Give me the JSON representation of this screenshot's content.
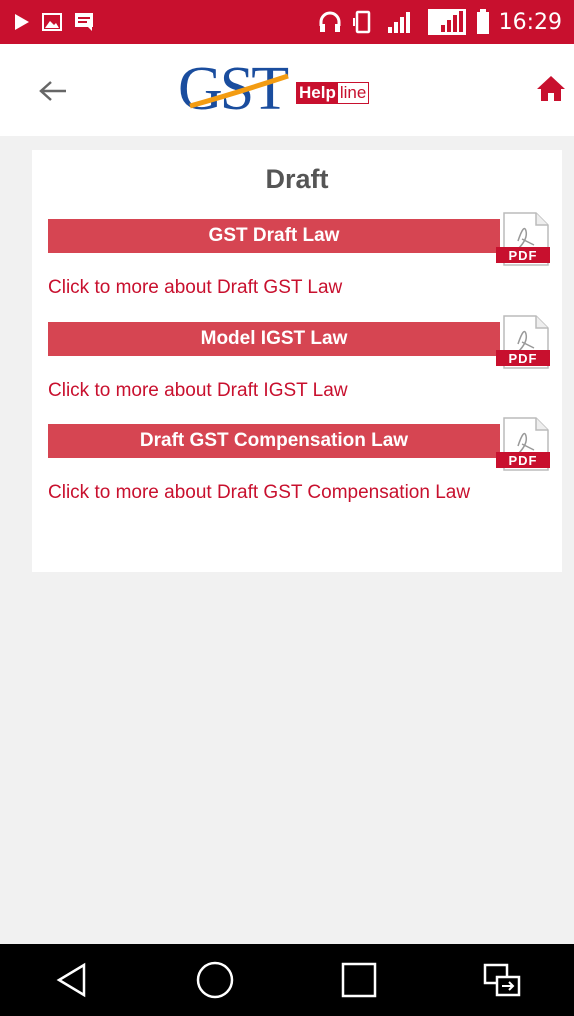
{
  "status_bar": {
    "time": "16:29",
    "icons": [
      "play-icon",
      "image-icon",
      "message-icon",
      "headset-icon",
      "vibrate-icon",
      "signal-icon",
      "signal-icon",
      "battery-icon"
    ]
  },
  "app_bar": {
    "logo_gst": "GST",
    "logo_help": "Help",
    "logo_line": "line",
    "back_icon": "arrow-left-icon",
    "home_icon": "home-icon"
  },
  "card": {
    "title": "Draft",
    "items": [
      {
        "heading": "GST Draft Law",
        "link": "Click to more about Draft GST Law",
        "icon_label": "PDF"
      },
      {
        "heading": "Model IGST Law",
        "link": "Click to more about Draft IGST Law",
        "icon_label": "PDF"
      },
      {
        "heading": "Draft GST Compensation Law",
        "link": "Click to more about Draft GST Compensation Law",
        "icon_label": "PDF"
      }
    ]
  },
  "nav_bar": {
    "buttons": [
      "back-triangle-icon",
      "home-circle-icon",
      "recents-square-icon",
      "switch-app-icon"
    ]
  },
  "colors": {
    "status_bar": "#c8102e",
    "accent": "#c8102e",
    "bar": "#d64552",
    "logo_blue": "#1a4d9e",
    "background": "#f1f1f1"
  }
}
